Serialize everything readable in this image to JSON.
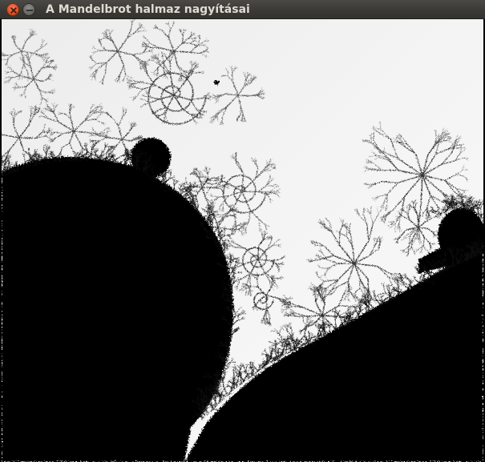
{
  "window": {
    "title": "A Mandelbrot halmaz nagyításai",
    "buttons": {
      "close_icon": "close-icon",
      "minimize_icon": "minimize-icon"
    }
  },
  "colors": {
    "titlebar": "#3c3b37",
    "title_text": "#dfdbd2",
    "close_button": "#e4532b",
    "background": "#f2f2f2",
    "set": "#000000"
  }
}
